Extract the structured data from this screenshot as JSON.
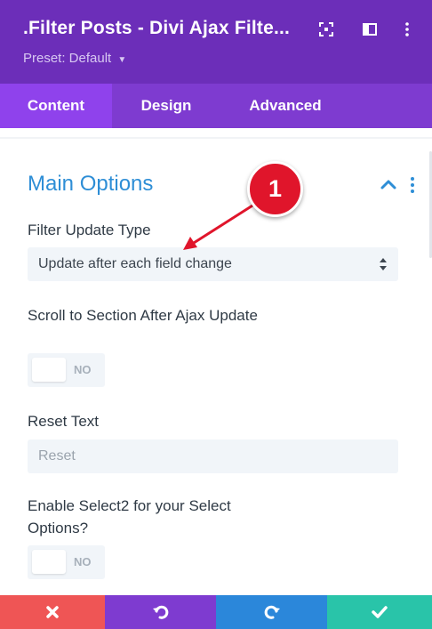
{
  "header": {
    "title": ".Filter Posts - Divi Ajax Filte...",
    "preset": "Preset: Default",
    "icons": [
      "focus-icon",
      "sidebar-icon",
      "more-vertical-icon"
    ]
  },
  "tabs": [
    {
      "label": "Content",
      "active": true
    },
    {
      "label": "Design",
      "active": false
    },
    {
      "label": "Advanced",
      "active": false
    }
  ],
  "section": {
    "title": "Main Options"
  },
  "fields": {
    "filter_update_type": {
      "label": "Filter Update Type",
      "value": "Update after each field change"
    },
    "scroll_to_section": {
      "label": "Scroll to Section After Ajax Update",
      "state": "NO"
    },
    "reset_text": {
      "label": "Reset Text",
      "placeholder": "Reset"
    },
    "enable_select2": {
      "label": "Enable Select2 for your Select Options?",
      "state": "NO"
    }
  },
  "annotation": {
    "badge_number": "1"
  },
  "footer": {
    "buttons": [
      "close-icon",
      "undo-icon",
      "redo-icon",
      "check-icon"
    ]
  },
  "colors": {
    "header_bg": "#6c2eb9",
    "tab_bar_bg": "#7e3bd0",
    "tab_active_bg": "#8f42ec",
    "section_title": "#2e8ed6",
    "badge": "#e0152b",
    "footer_close": "#ef5555",
    "footer_undo": "#7e3bd0",
    "footer_redo": "#2b87da",
    "footer_save": "#29c4a9"
  }
}
